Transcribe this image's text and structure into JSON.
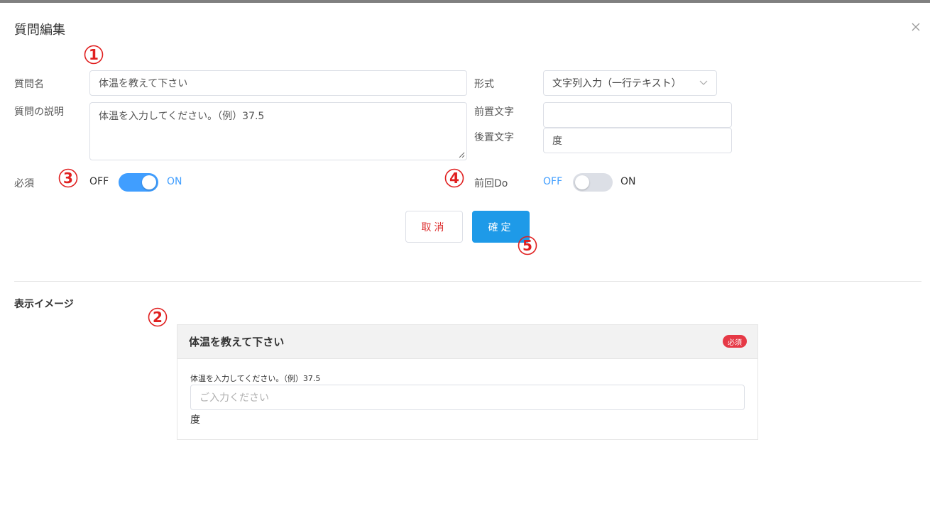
{
  "dialog": {
    "title": "質問編集"
  },
  "markers": [
    "①",
    "②",
    "③",
    "④",
    "⑤"
  ],
  "form": {
    "question_name_label": "質問名",
    "question_name_value": "体温を教えて下さい",
    "description_label": "質問の説明",
    "description_value": "体温を入力してください。（例）37.5",
    "format_label": "形式",
    "format_value": "文字列入力（一行テキスト）",
    "prefix_label": "前置文字",
    "prefix_value": "",
    "suffix_label": "後置文字",
    "suffix_value": "度",
    "required_label": "必須",
    "required_off": "OFF",
    "required_on": "ON",
    "required_state": true,
    "prev_do_label": "前回Do",
    "prev_do_off": "OFF",
    "prev_do_on": "ON",
    "prev_do_state": false
  },
  "buttons": {
    "cancel": "取消",
    "confirm": "確定"
  },
  "preview": {
    "section_title": "表示イメージ",
    "question": "体温を教えて下さい",
    "badge": "必須",
    "description": "体温を入力してください。（例）37.5",
    "input_placeholder": "ご入力ください",
    "suffix": "度"
  },
  "colors": {
    "accent": "#1e9ae8",
    "switch_on": "#409eff",
    "switch_off": "#dcdfe6",
    "marker_red": "#e02020",
    "badge_red": "#e63946"
  }
}
